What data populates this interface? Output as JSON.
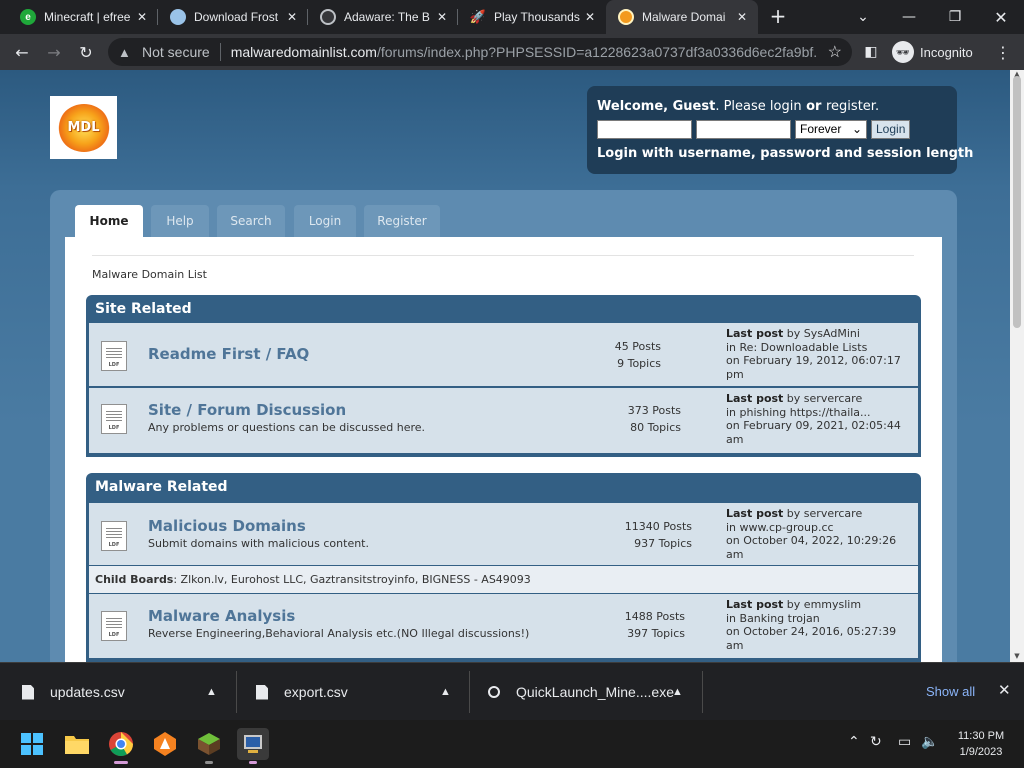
{
  "browser": {
    "tabs": [
      {
        "title": "Minecraft | efree",
        "favicon_color": "#1fa83a",
        "favicon_text": "e"
      },
      {
        "title": "Download Frost",
        "favicon_color": "#9ac3e8",
        "favicon_text": ""
      },
      {
        "title": "Adaware: The B",
        "favicon_color": "#bdc1c6",
        "favicon_text": ""
      },
      {
        "title": "Play Thousands",
        "favicon_color": "#8f6ef0",
        "favicon_text": ""
      },
      {
        "title": "Malware Domai",
        "favicon_color": "#f39a1e",
        "favicon_text": ""
      }
    ],
    "not_secure": "Not secure",
    "url_host": "malwaredomainlist.com",
    "url_path": "/forums/index.php?PHPSESSID=a1228623a0737df3a0336d6ec2fa9bf...",
    "profile": "Incognito"
  },
  "page": {
    "logo_text": "MDL",
    "login": {
      "welcome_prefix": "Welcome, ",
      "guest": "Guest",
      "please": ". Please ",
      "login_link": "login",
      "or": " or ",
      "register_link": "register",
      "dot": ".",
      "session_value": "Forever",
      "login_button": "Login",
      "hint": "Login with username, password and session length"
    },
    "nav": [
      "Home",
      "Help",
      "Search",
      "Login",
      "Register"
    ],
    "breadcrumb": "Malware Domain List",
    "categories": [
      {
        "title": "Site Related",
        "boards": [
          {
            "name": "Readme First / FAQ",
            "desc": "",
            "posts": "45 Posts",
            "topics": "9 Topics",
            "last_label": "Last post",
            "last_by": " by SysAdMini",
            "last_in": "in Re: Downloadable Lists",
            "last_on": "on February 19, 2012, 06:07:17",
            "last_on2": "pm"
          },
          {
            "name": "Site / Forum Discussion",
            "desc": "Any problems or questions can be discussed here.",
            "posts": "373 Posts",
            "topics": "80 Topics",
            "last_label": "Last post",
            "last_by": " by servercare",
            "last_in": "in phishing https://thaila...",
            "last_on": "on February 09, 2021, 02:05:44",
            "last_on2": "am"
          }
        ]
      },
      {
        "title": "Malware Related",
        "boards": [
          {
            "name": "Malicious Domains",
            "desc": "Submit domains with malicious content.",
            "posts": "11340 Posts",
            "topics": "937 Topics",
            "last_label": "Last post",
            "last_by": " by servercare",
            "last_in": "in www.cp-group.cc",
            "last_on": "on October 04, 2022, 10:29:26",
            "last_on2": "am"
          },
          {
            "name": "Malware Analysis",
            "desc": "Reverse Engineering,Behavioral Analysis etc.(NO Illegal discussions!)",
            "posts": "1488 Posts",
            "topics": "397 Topics",
            "last_label": "Last post",
            "last_by": " by emmyslim",
            "last_in": "in Banking trojan",
            "last_on": "on October 24, 2016, 05:27:39",
            "last_on2": "am"
          }
        ],
        "child_boards_label": "Child Boards",
        "child_boards": ": Zlkon.lv, Eurohost LLC, Gaztransitstroyinfo, BIGNESS - AS49093"
      }
    ]
  },
  "downloads": {
    "items": [
      "updates.csv",
      "export.csv",
      "QuickLaunch_Mine....exe"
    ],
    "show_all": "Show all"
  },
  "taskbar": {
    "time": "11:30 PM",
    "date": "1/9/2023"
  }
}
